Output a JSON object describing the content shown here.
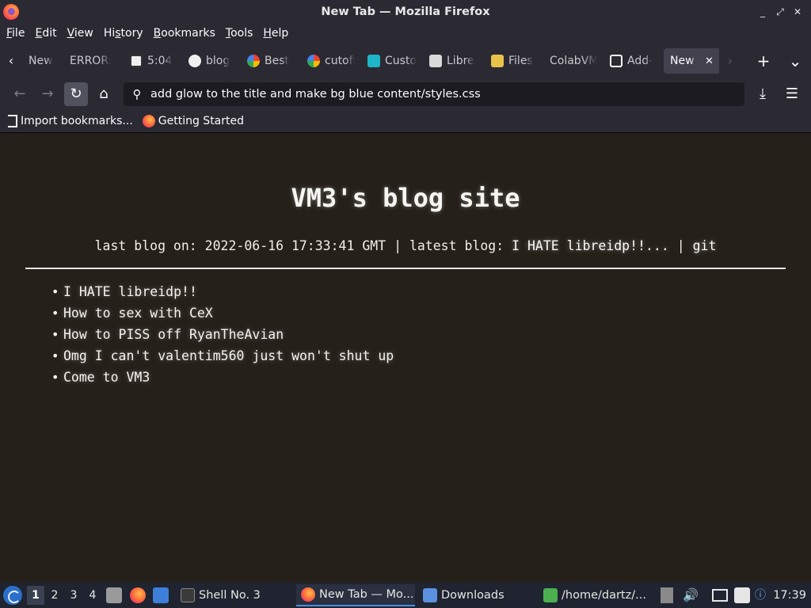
{
  "window": {
    "title": "New Tab — Mozilla Firefox",
    "controls": [
      "_",
      "⤢",
      "✕"
    ]
  },
  "menubar": {
    "items": [
      {
        "pre": "",
        "u": "F",
        "post": "ile"
      },
      {
        "pre": "",
        "u": "E",
        "post": "dit"
      },
      {
        "pre": "",
        "u": "V",
        "post": "iew"
      },
      {
        "pre": "Hi",
        "u": "s",
        "post": "tory"
      },
      {
        "pre": "",
        "u": "B",
        "post": "ookmarks"
      },
      {
        "pre": "",
        "u": "T",
        "post": "ools"
      },
      {
        "pre": "",
        "u": "H",
        "post": "elp"
      }
    ]
  },
  "tabs": {
    "items": [
      {
        "label": "New",
        "icon": "none",
        "active": false
      },
      {
        "label": "ERROR:",
        "icon": "none",
        "active": false
      },
      {
        "label": "5:04",
        "icon": "calendar-icon",
        "active": false
      },
      {
        "label": "blog",
        "icon": "github-icon",
        "active": false
      },
      {
        "label": "Best",
        "icon": "google-icon",
        "active": false
      },
      {
        "label": "cutoff",
        "icon": "google-icon",
        "active": false
      },
      {
        "label": "Custom",
        "icon": "puzzle-icon",
        "active": false
      },
      {
        "label": "Libre",
        "icon": "stack-icon",
        "active": false
      },
      {
        "label": "Files",
        "icon": "folder-icon",
        "active": false
      },
      {
        "label": "ColabVM",
        "icon": "none",
        "active": false
      },
      {
        "label": "Add-",
        "icon": "addon-icon",
        "active": false
      },
      {
        "label": "New Tab",
        "icon": "none",
        "active": true
      }
    ],
    "close_glyph": "✕",
    "scroll_left": "‹",
    "scroll_right": "›",
    "new_tab": "+",
    "list_all": "⌄"
  },
  "navbar": {
    "url": "add glow to the title and make bg blue content/styles.css"
  },
  "bookmarks": {
    "items": [
      {
        "label": "Import bookmarks...",
        "icon": "import-icon"
      },
      {
        "label": "Getting Started",
        "icon": "firefox-icon"
      }
    ]
  },
  "page": {
    "title": "VM3's blog site",
    "meta_prefix": "last blog on: 2022-06-16 17:33:41 GMT | latest blog: ",
    "meta_latest": "I HATE libreidp!!...",
    "meta_sep": " | ",
    "meta_git": "git",
    "posts": [
      "I HATE libreidp!!",
      "How to sex with CeX",
      "How to PISS off RyanTheAvian",
      "Omg I can't valentim560 just won't shut up",
      "Come to VM3"
    ]
  },
  "taskbar": {
    "workspaces": [
      "1",
      "2",
      "3",
      "4"
    ],
    "active_workspace": "1",
    "tasks": [
      {
        "label": "Shell No. 3",
        "icon": "terminal-icon"
      },
      {
        "label": "New Tab — Mo...",
        "icon": "firefox-icon",
        "active": true
      },
      {
        "label": "Downloads",
        "icon": "folder-icon"
      },
      {
        "label": "/home/dartz/...",
        "icon": "editor-icon"
      }
    ],
    "clock": "17:39"
  }
}
